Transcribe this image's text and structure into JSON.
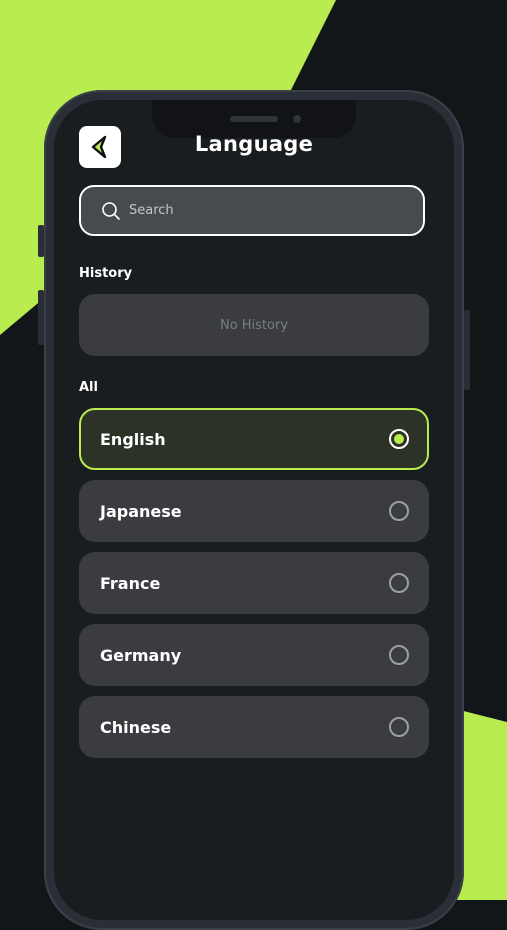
{
  "header": {
    "title": "Language"
  },
  "search": {
    "placeholder": "Search"
  },
  "history": {
    "label": "History",
    "empty_text": "No History"
  },
  "all": {
    "label": "All",
    "languages": [
      {
        "label": "English",
        "selected": true
      },
      {
        "label": "Japanese",
        "selected": false
      },
      {
        "label": "France",
        "selected": false
      },
      {
        "label": "Germany",
        "selected": false
      },
      {
        "label": "Chinese",
        "selected": false
      }
    ]
  },
  "colors": {
    "accent": "#b8ec4f",
    "background": "#111718",
    "card": "#3a3c3f"
  },
  "icons": {
    "back": "chevron-left-icon",
    "search": "search-icon"
  }
}
